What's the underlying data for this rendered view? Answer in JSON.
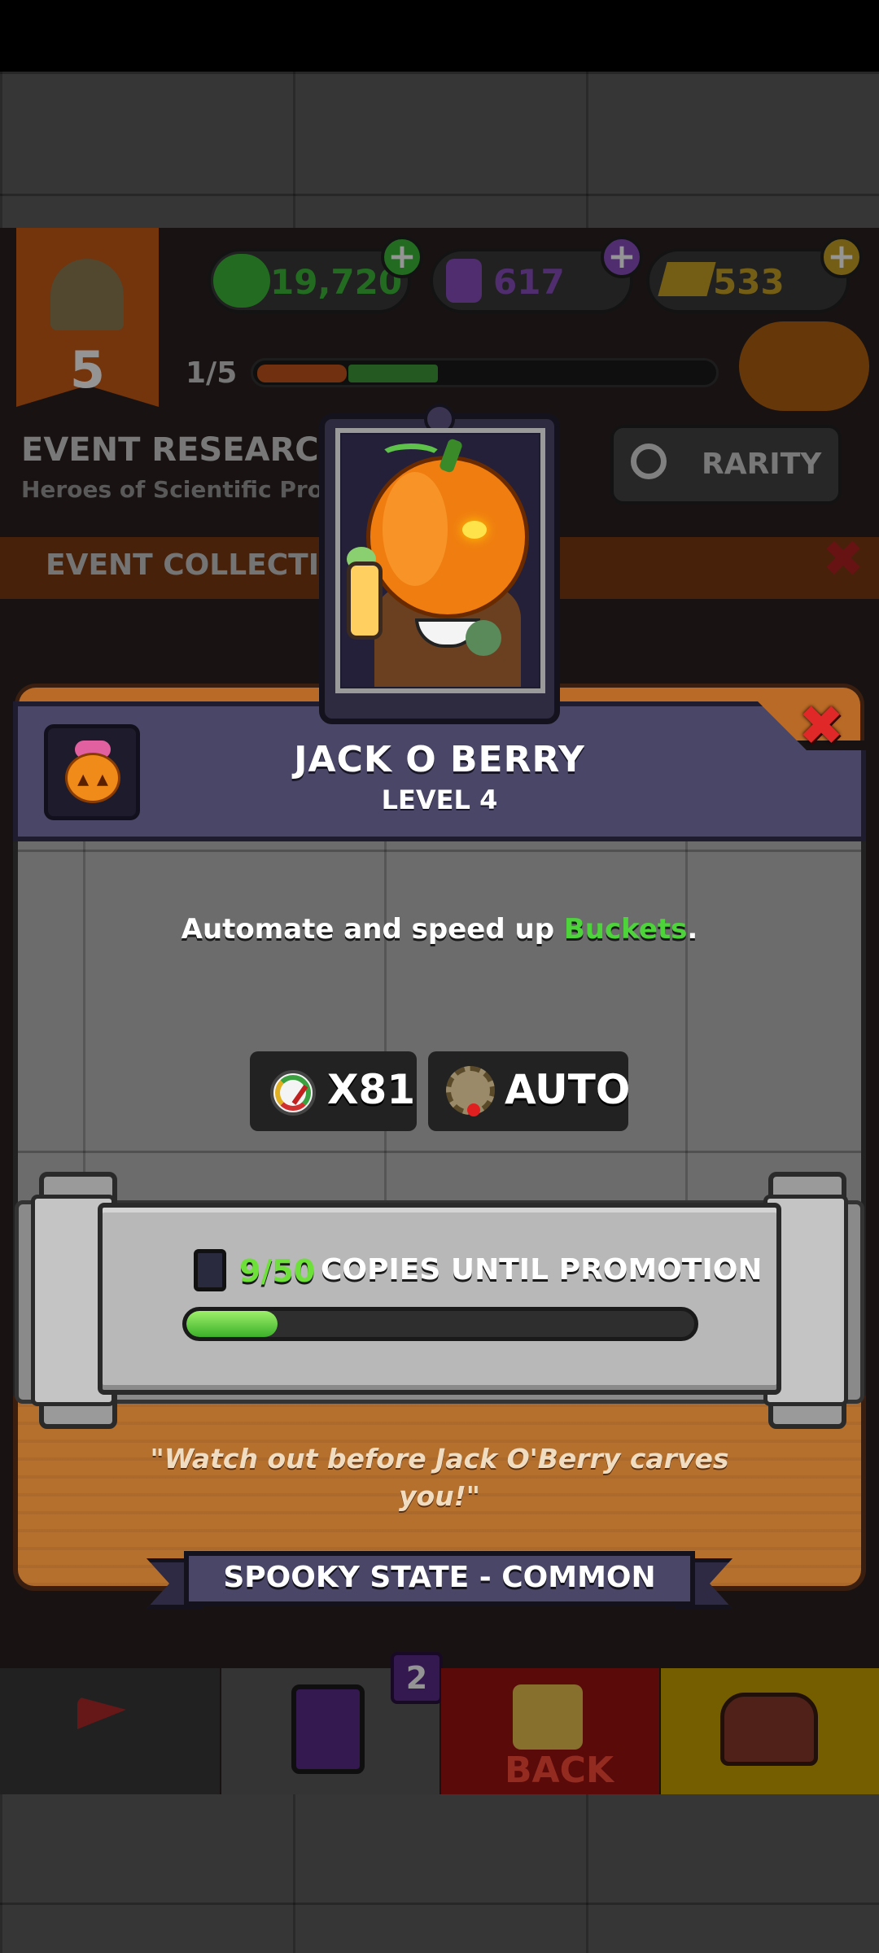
{
  "header": {
    "rank_number": "5",
    "resources": [
      {
        "value": "19,720",
        "color": "#3db83a"
      },
      {
        "value": "617",
        "color": "#8a4fc0"
      },
      {
        "value": "533",
        "color": "#c9a227"
      }
    ],
    "progress_text": "1/5",
    "event_title": "EVENT RESEARCH",
    "event_subtitle": "Heroes of Scientific Prog",
    "rarity_label": "RARITY",
    "event_collection_label": "EVENT COLLECTIO"
  },
  "bottom_nav": {
    "cards_badge": "2",
    "back_label": "BACK",
    "items": [
      {
        "icon": "flag-icon"
      },
      {
        "icon": "cards-icon"
      },
      {
        "icon": "back-icon"
      },
      {
        "icon": "chest-icon"
      }
    ]
  },
  "dialog": {
    "name": "JACK O BERRY",
    "level": "LEVEL 4",
    "description_prefix": "Automate and speed up ",
    "description_highlight": "Buckets",
    "description_suffix": ".",
    "stats": [
      {
        "icon": "speed-gauge-icon",
        "value": "X81"
      },
      {
        "icon": "gear-auto-icon",
        "value": "AUTO"
      }
    ],
    "copies_count": "9/50",
    "copies_label": "COPIES UNTIL PROMOTION",
    "copies_progress": 0.18,
    "quote": "\"Watch out before Jack O'Berry carves you!\"",
    "rarity_ribbon": "SPOOKY STATE - COMMON",
    "highlight_color": "#4cd43a",
    "progress_color": "#6ee03a"
  }
}
